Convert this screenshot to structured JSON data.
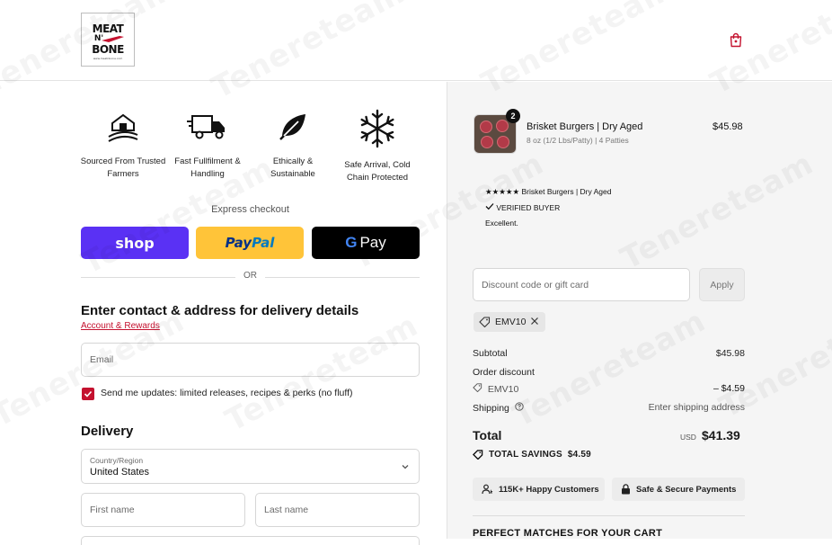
{
  "header": {
    "logo": {
      "line1": "MEAT",
      "line2": "N'",
      "line3": "BONE",
      "small": "www.meatnbone.com"
    },
    "cart_icon": "shopping-bag-icon"
  },
  "features": [
    {
      "icon": "barn-icon",
      "label": "Sourced From Trusted Farmers"
    },
    {
      "icon": "truck-icon",
      "label": "Fast Fullfilment & Handling"
    },
    {
      "icon": "leaf-icon",
      "label": "Ethically & Sustainable"
    },
    {
      "icon": "snowflake-icon",
      "label": "Safe Arrival, Cold Chain Protected"
    }
  ],
  "express": {
    "title": "Express checkout",
    "shop_label": "shop",
    "paypal_label_1": "Pay",
    "paypal_label_2": "Pal",
    "gpay_g": "G",
    "gpay_label": "Pay",
    "or": "OR",
    "colors": {
      "shop": "#5a31f4",
      "paypal": "#ffc439",
      "gpay": "#000000"
    }
  },
  "contact": {
    "title": "Enter contact & address for delivery details",
    "rewards_link": "Account & Rewards",
    "email_placeholder": "Email",
    "updates_checked": true,
    "updates_label": "Send me updates: limited releases, recipes & perks (no fluff)"
  },
  "delivery": {
    "title": "Delivery",
    "country_label": "Country/Region",
    "country_value": "United States",
    "first_name_placeholder": "First name",
    "last_name_placeholder": "Last name"
  },
  "cart": {
    "item": {
      "name": "Brisket Burgers | Dry Aged",
      "variant": "8 oz (1/2 Lbs/Patty) | 4 Patties",
      "price": "$45.98",
      "quantity": "2"
    },
    "review": {
      "stars": "★★★★★",
      "product": "Brisket Burgers | Dry Aged",
      "verified": "VERIFIED BUYER",
      "text": "Excellent."
    },
    "discount_placeholder": "Discount code or gift card",
    "apply_label": "Apply",
    "code": "EMV10",
    "summary": {
      "subtotal_label": "Subtotal",
      "subtotal_value": "$45.98",
      "order_discount_label": "Order discount",
      "discount_code": "EMV10",
      "discount_value": "– $4.59",
      "shipping_label": "Shipping",
      "shipping_value": "Enter shipping address",
      "total_label": "Total",
      "currency": "USD",
      "total_value": "$41.39",
      "savings_label": "TOTAL SAVINGS",
      "savings_value": "$4.59"
    },
    "trust": {
      "customers": "115K+ Happy Customers",
      "secure": "Safe & Secure Payments"
    },
    "matches_title": "PERFECT MATCHES FOR YOUR CART"
  },
  "watermark": "Tenereteam",
  "accent_color": "#c4122f"
}
